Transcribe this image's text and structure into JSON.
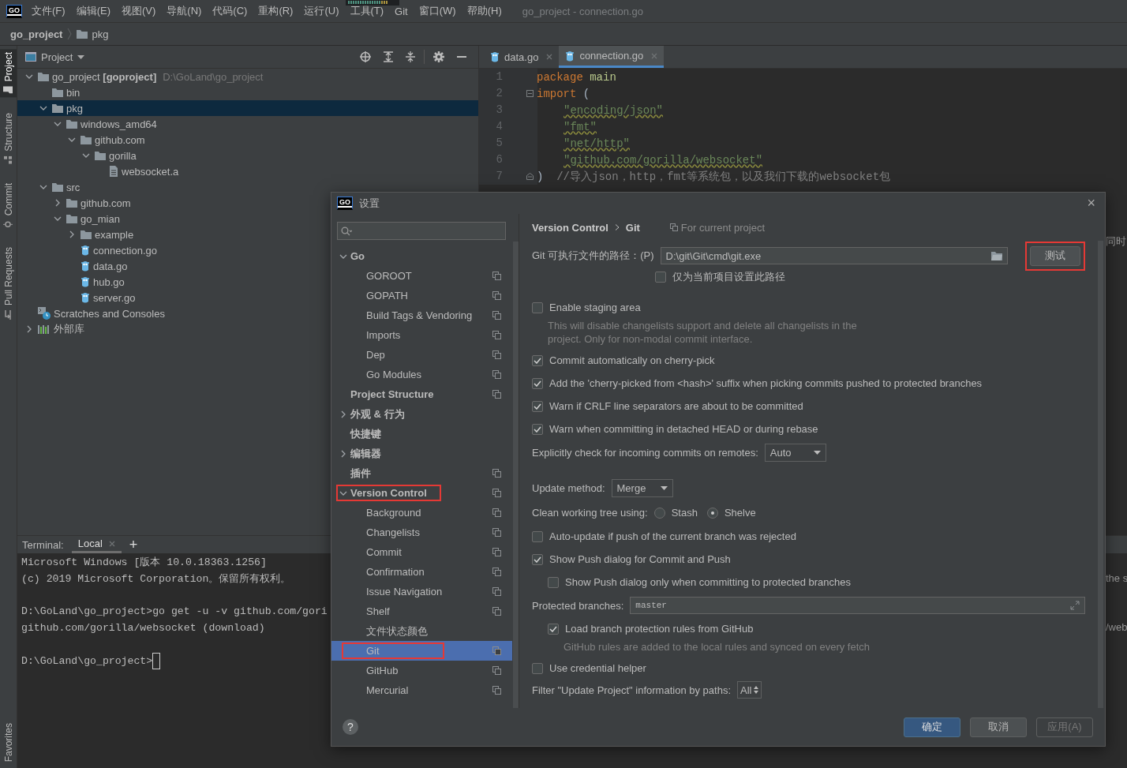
{
  "menubar": {
    "logo": "GO",
    "items": [
      "文件(F)",
      "编辑(E)",
      "视图(V)",
      "导航(N)",
      "代码(C)",
      "重构(R)",
      "运行(U)",
      "工具(T)",
      "Git",
      "窗口(W)",
      "帮助(H)"
    ],
    "title": "go_project - connection.go"
  },
  "navbar": {
    "crumbs": [
      {
        "label": "go_project",
        "kind": "project"
      },
      {
        "label": "pkg",
        "kind": "folder"
      }
    ]
  },
  "tool_strip": {
    "top": [
      {
        "label": "Project",
        "kind": "folder",
        "selected": true
      },
      {
        "label": "Structure",
        "kind": "structure",
        "selected": false
      },
      {
        "label": "Commit",
        "kind": "commit",
        "selected": false
      },
      {
        "label": "Pull Requests",
        "kind": "pull",
        "selected": false
      }
    ],
    "bottom": [
      {
        "label": "Favorites",
        "selected": false
      }
    ]
  },
  "project_panel": {
    "title": "Project",
    "tree": [
      {
        "label": "go_project **[goproject]**",
        "path": "D:\\GoLand\\go_project",
        "kind": "folder",
        "expanded": true,
        "selected": false,
        "children": [
          {
            "label": "bin",
            "kind": "folder",
            "selected": false
          },
          {
            "label": "pkg",
            "kind": "folder",
            "expanded": true,
            "selected": true,
            "children": [
              {
                "label": "windows_amd64",
                "kind": "folder",
                "expanded": true,
                "selected": false,
                "children": [
                  {
                    "label": "github.com",
                    "kind": "folder",
                    "expanded": true,
                    "selected": false,
                    "children": [
                      {
                        "label": "gorilla",
                        "kind": "folder",
                        "expanded": true,
                        "selected": false,
                        "children": [
                          {
                            "label": "websocket.a",
                            "kind": "file",
                            "selected": false
                          }
                        ]
                      }
                    ]
                  }
                ]
              }
            ]
          },
          {
            "label": "src",
            "kind": "folder",
            "expanded": true,
            "selected": false,
            "children": [
              {
                "label": "github.com",
                "kind": "folder",
                "expanded": false,
                "selected": false
              },
              {
                "label": "go_mian",
                "kind": "folder",
                "expanded": true,
                "selected": false,
                "children": [
                  {
                    "label": "example",
                    "kind": "folder",
                    "expanded": false,
                    "selected": false
                  },
                  {
                    "label": "connection.go",
                    "kind": "gofile",
                    "selected": false
                  },
                  {
                    "label": "data.go",
                    "kind": "gofile",
                    "selected": false
                  },
                  {
                    "label": "hub.go",
                    "kind": "gofile",
                    "selected": false
                  },
                  {
                    "label": "server.go",
                    "kind": "gofile",
                    "selected": false
                  }
                ]
              }
            ]
          }
        ]
      },
      {
        "label": "Scratches and Consoles",
        "kind": "scratches",
        "selected": false
      },
      {
        "label": "外部库",
        "kind": "library",
        "expanded": false,
        "selected": false
      }
    ]
  },
  "editor": {
    "tabs": [
      {
        "label": "data.go",
        "selected": false
      },
      {
        "label": "connection.go",
        "selected": true
      }
    ],
    "lines": [
      {
        "number": "1",
        "tokens": [
          {
            "kind": "keyword",
            "text": "package"
          },
          {
            "kind": "ident",
            "text": " main"
          }
        ]
      },
      {
        "number": "2",
        "fold_start": true,
        "tokens": [
          {
            "kind": "keyword",
            "text": "import"
          },
          {
            "kind": "plain",
            "text": " ("
          }
        ]
      },
      {
        "number": "3",
        "kind": "block",
        "tokens": [
          {
            "kind": "string",
            "text": "\"encoding/json\""
          }
        ]
      },
      {
        "number": "4",
        "kind": "block",
        "tokens": [
          {
            "kind": "string",
            "text": "\"fmt\""
          }
        ]
      },
      {
        "number": "5",
        "kind": "block",
        "tokens": [
          {
            "kind": "string",
            "text": "\"net/http\""
          }
        ]
      },
      {
        "number": "6",
        "kind": "block",
        "tokens": [
          {
            "kind": "string",
            "text": "\"github.com/gorilla/websocket\""
          }
        ]
      },
      {
        "number": "7",
        "fold_end": true,
        "tokens": [
          {
            "kind": "plain",
            "text": ")"
          },
          {
            "kind": "comment",
            "text": "  //导入json，http，fmt等系统包，以及我们下载的websocket包"
          }
        ]
      }
    ],
    "peek": [
      "同时",
      "the s",
      "/web"
    ]
  },
  "terminal": {
    "label": "Terminal:",
    "tabs": [
      {
        "label": "Local",
        "selected": true
      }
    ],
    "add": "+",
    "cursor": true,
    "blocks": [
      [
        "Microsoft Windows [版本 10.0.18363.1256]",
        "(c) 2019 Microsoft Corporation。保留所有权利。"
      ],
      [
        "D:\\GoLand\\go_project>go get -u -v github.com/gori",
        "github.com/gorilla/websocket (download)"
      ],
      [
        "D:\\GoLand\\go_project>"
      ]
    ]
  },
  "dialog": {
    "logo": "GO",
    "title": "设置",
    "close": "×",
    "nav": [
      {
        "label": "Go",
        "expanded": true,
        "selected": false,
        "highlighted": false,
        "project_scope": false,
        "children": [
          {
            "label": "GOROOT",
            "selected": false,
            "highlighted": false,
            "project_scope": true
          },
          {
            "label": "GOPATH",
            "selected": false,
            "highlighted": false,
            "project_scope": true
          },
          {
            "label": "Build Tags & Vendoring",
            "selected": false,
            "highlighted": false,
            "project_scope": true
          },
          {
            "label": "Imports",
            "selected": false,
            "highlighted": false,
            "project_scope": true
          },
          {
            "label": "Dep",
            "selected": false,
            "highlighted": false,
            "project_scope": true
          },
          {
            "label": "Go Modules",
            "selected": false,
            "highlighted": false,
            "project_scope": true
          }
        ]
      },
      {
        "label": "Project Structure",
        "selected": false,
        "highlighted": false,
        "project_scope": true
      },
      {
        "label": "外观 & 行为",
        "expanded": false,
        "selected": false,
        "highlighted": false,
        "project_scope": false
      },
      {
        "label": "快捷键",
        "selected": false,
        "highlighted": false,
        "project_scope": false
      },
      {
        "label": "编辑器",
        "expanded": false,
        "selected": false,
        "highlighted": false,
        "project_scope": false
      },
      {
        "label": "插件",
        "selected": false,
        "highlighted": false,
        "project_scope": true
      },
      {
        "label": "Version Control",
        "expanded": true,
        "selected": false,
        "highlighted": true,
        "project_scope": true,
        "children": [
          {
            "label": "Background",
            "selected": false,
            "highlighted": false,
            "project_scope": true
          },
          {
            "label": "Changelists",
            "selected": false,
            "highlighted": false,
            "project_scope": true
          },
          {
            "label": "Commit",
            "selected": false,
            "highlighted": false,
            "project_scope": true
          },
          {
            "label": "Confirmation",
            "selected": false,
            "highlighted": false,
            "project_scope": true
          },
          {
            "label": "Issue Navigation",
            "selected": false,
            "highlighted": false,
            "project_scope": true
          },
          {
            "label": "Shelf",
            "selected": false,
            "highlighted": false,
            "project_scope": true
          },
          {
            "label": "文件状态颜色",
            "selected": false,
            "highlighted": false,
            "project_scope": false
          },
          {
            "label": "Git",
            "selected": true,
            "highlighted": true,
            "project_scope": true
          },
          {
            "label": "GitHub",
            "selected": false,
            "highlighted": false,
            "project_scope": true
          },
          {
            "label": "Mercurial",
            "selected": false,
            "highlighted": false,
            "project_scope": true
          }
        ]
      }
    ],
    "breadcrumb": [
      "Version Control",
      "Git"
    ],
    "scope_note": "For current project",
    "sections": [
      [
        {
          "kind": "path",
          "label": "Git 可执行文件的路径：(P)",
          "value": "D:\\git\\Git\\cmd\\git.exe",
          "button": {
            "label": "测试",
            "highlighted": true
          },
          "children": [
            {
              "kind": "checkbox",
              "label": "仅为当前项目设置此路径",
              "checked": false
            }
          ]
        }
      ],
      [
        {
          "kind": "checkbox",
          "label": "Enable staging area",
          "checked": false,
          "note": "This will disable changelists support and delete all changelists in the project. Only for non-modal commit interface."
        },
        {
          "kind": "checkbox",
          "label": "Commit automatically on cherry-pick",
          "checked": true
        },
        {
          "kind": "checkbox",
          "label": "Add the 'cherry-picked from <hash>' suffix when picking commits pushed to protected branches",
          "checked": true
        },
        {
          "kind": "checkbox",
          "label": "Warn if CRLF line separators are about to be committed",
          "checked": true
        },
        {
          "kind": "checkbox",
          "label": "Warn when committing in detached HEAD or during rebase",
          "checked": true
        },
        {
          "kind": "dropdown",
          "label": "Explicitly check for incoming commits on remotes:",
          "value": "Auto"
        }
      ],
      [
        {
          "kind": "dropdown",
          "label": "Update method:",
          "value": "Merge"
        },
        {
          "kind": "radio",
          "label": "Clean working tree using:",
          "options": [
            {
              "label": "Stash",
              "selected": false
            },
            {
              "label": "Shelve",
              "selected": true
            }
          ]
        },
        {
          "kind": "checkbox",
          "label": "Auto-update if push of the current branch was rejected",
          "checked": false
        },
        {
          "kind": "checkbox",
          "label": "Show Push dialog for Commit and Push",
          "checked": true,
          "children": [
            {
              "kind": "checkbox",
              "label": "Show Push dialog only when committing to protected branches",
              "checked": false
            }
          ]
        },
        {
          "kind": "text",
          "label": "Protected branches:",
          "value": "master",
          "children": [
            {
              "kind": "checkbox",
              "label": "Load branch protection rules from GitHub",
              "checked": true,
              "note": "GitHub rules are added to the local rules and synced on every fetch"
            }
          ]
        },
        {
          "kind": "checkbox",
          "label": "Use credential helper",
          "checked": false
        },
        {
          "kind": "spinner",
          "label": "Filter \"Update Project\" information by paths:",
          "value": "All"
        }
      ]
    ],
    "help": "?",
    "buttons": [
      {
        "label": "确定",
        "kind": "primary",
        "disabled": false
      },
      {
        "label": "取消",
        "kind": "normal",
        "disabled": false
      },
      {
        "label": "应用(A)",
        "kind": "normal",
        "disabled": true
      }
    ]
  }
}
